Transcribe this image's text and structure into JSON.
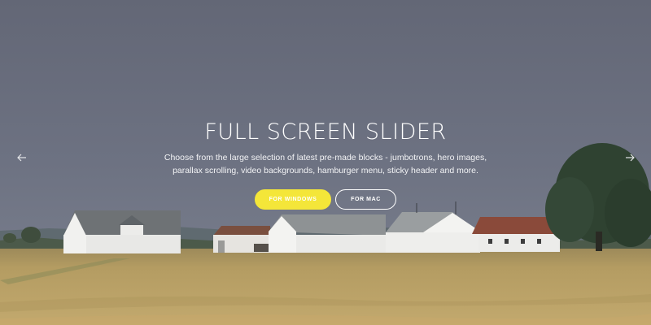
{
  "hero": {
    "title": "FULL SCREEN SLIDER",
    "description": "Choose from the large selection of latest pre-made blocks - jumbotrons, hero images, parallax scrolling, video backgrounds, hamburger menu, sticky header and more.",
    "primary_button": "FOR WINDOWS",
    "secondary_button": "FOR MAC"
  },
  "controls": {
    "prev_icon": "arrow-left-icon",
    "next_icon": "arrow-right-icon"
  },
  "colors": {
    "sky": "#6b707f",
    "field": "#b79e5f",
    "accent": "#f4e639",
    "text": "#ffffff"
  }
}
